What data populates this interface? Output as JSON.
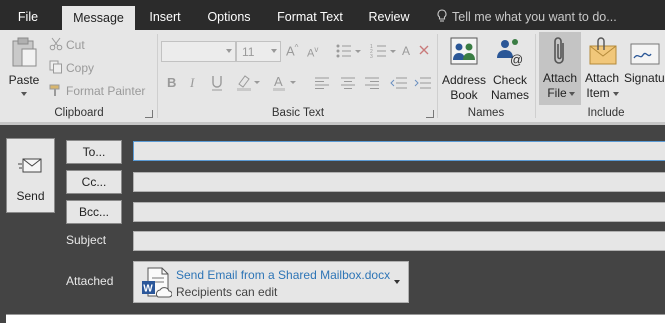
{
  "tabs": [
    {
      "label": "File"
    },
    {
      "label": "Message"
    },
    {
      "label": "Insert"
    },
    {
      "label": "Options"
    },
    {
      "label": "Format Text"
    },
    {
      "label": "Review"
    }
  ],
  "tell_me": "Tell me what you want to do...",
  "clipboard": {
    "group_label": "Clipboard",
    "paste": "Paste",
    "cut": "Cut",
    "copy": "Copy",
    "format_painter": "Format Painter"
  },
  "basic_text": {
    "group_label": "Basic Text",
    "font_size": "11",
    "bold": "B",
    "italic": "I"
  },
  "names": {
    "group_label": "Names",
    "address_book_line1": "Address",
    "address_book_line2": "Book",
    "check_names_line1": "Check",
    "check_names_line2": "Names"
  },
  "include": {
    "group_label": "Include",
    "attach_file_line1": "Attach",
    "attach_file_line2": "File",
    "attach_item_line1": "Attach",
    "attach_item_line2": "Item",
    "signature_line1": "Signatu"
  },
  "compose": {
    "send": "Send",
    "to": "To...",
    "cc": "Cc...",
    "bcc": "Bcc...",
    "subject_label": "Subject",
    "attached_label": "Attached"
  },
  "attachment": {
    "name": "Send Email from a Shared Mailbox.docx",
    "subtitle": "Recipients can edit"
  },
  "colors": {
    "accent_link": "#2e75b6",
    "ribbon_bg": "#e6e6e6",
    "titlebar_bg": "#2b2b2b",
    "compose_bg": "#444444"
  }
}
